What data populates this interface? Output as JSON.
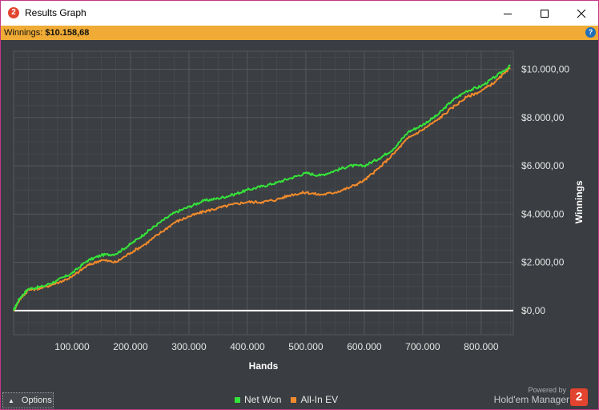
{
  "window": {
    "title": "Results Graph",
    "app_icon_glyph": "2",
    "icons": [
      "app-logo-icon",
      "minimize-icon",
      "maximize-icon",
      "close-icon"
    ]
  },
  "summary": {
    "label": "Winnings:",
    "value": "$10.158,68",
    "help_glyph": "?"
  },
  "footer": {
    "options_label": "Options",
    "powered_by": "Powered by",
    "brand": "Hold'em Manager",
    "brand_glyph": "2"
  },
  "colors": {
    "net_won": "#35e43a",
    "all_in_ev": "#f28b2c",
    "zero_line": "#ffffff",
    "plot_bg": "#3b3e42",
    "grid": "#4b4e52",
    "accent_bar": "#efab35"
  },
  "chart_data": {
    "type": "line",
    "xlabel": "Hands",
    "ylabel": "Winnings",
    "xlim": [
      0,
      855000
    ],
    "ylim": [
      -1000,
      10750
    ],
    "x_ticks": [
      100000,
      200000,
      300000,
      400000,
      500000,
      600000,
      700000,
      800000
    ],
    "x_tick_labels": [
      "100.000",
      "200.000",
      "300.000",
      "400.000",
      "500.000",
      "600.000",
      "700.000",
      "800.000"
    ],
    "y_ticks": [
      0,
      2000,
      4000,
      6000,
      8000,
      10000
    ],
    "y_tick_labels": [
      "$0,00",
      "$2.000,00",
      "$4.000,00",
      "$6.000,00",
      "$8.000,00",
      "$10.000,00"
    ],
    "grid": true,
    "legend_position": "bottom-center",
    "x": [
      0,
      10000,
      25000,
      50000,
      75000,
      100000,
      125000,
      150000,
      175000,
      200000,
      225000,
      250000,
      275000,
      300000,
      325000,
      350000,
      375000,
      400000,
      425000,
      450000,
      475000,
      500000,
      525000,
      550000,
      575000,
      600000,
      625000,
      650000,
      675000,
      700000,
      725000,
      750000,
      775000,
      800000,
      825000,
      850000
    ],
    "series": [
      {
        "name": "Net Won",
        "values": [
          0,
          500,
          900,
          1000,
          1250,
          1550,
          2050,
          2300,
          2350,
          2750,
          3200,
          3650,
          4050,
          4300,
          4550,
          4650,
          4800,
          5000,
          5150,
          5300,
          5500,
          5700,
          5600,
          5800,
          6000,
          6000,
          6300,
          6700,
          7400,
          7700,
          8100,
          8700,
          9100,
          9300,
          9700,
          10150
        ]
      },
      {
        "name": "All-In EV",
        "values": [
          0,
          450,
          850,
          950,
          1150,
          1400,
          1850,
          2100,
          2000,
          2400,
          2750,
          3200,
          3650,
          3900,
          4100,
          4250,
          4400,
          4500,
          4500,
          4600,
          4800,
          4900,
          4800,
          4900,
          5100,
          5400,
          5900,
          6500,
          7150,
          7500,
          7900,
          8400,
          8850,
          9100,
          9500,
          10050
        ]
      }
    ]
  }
}
